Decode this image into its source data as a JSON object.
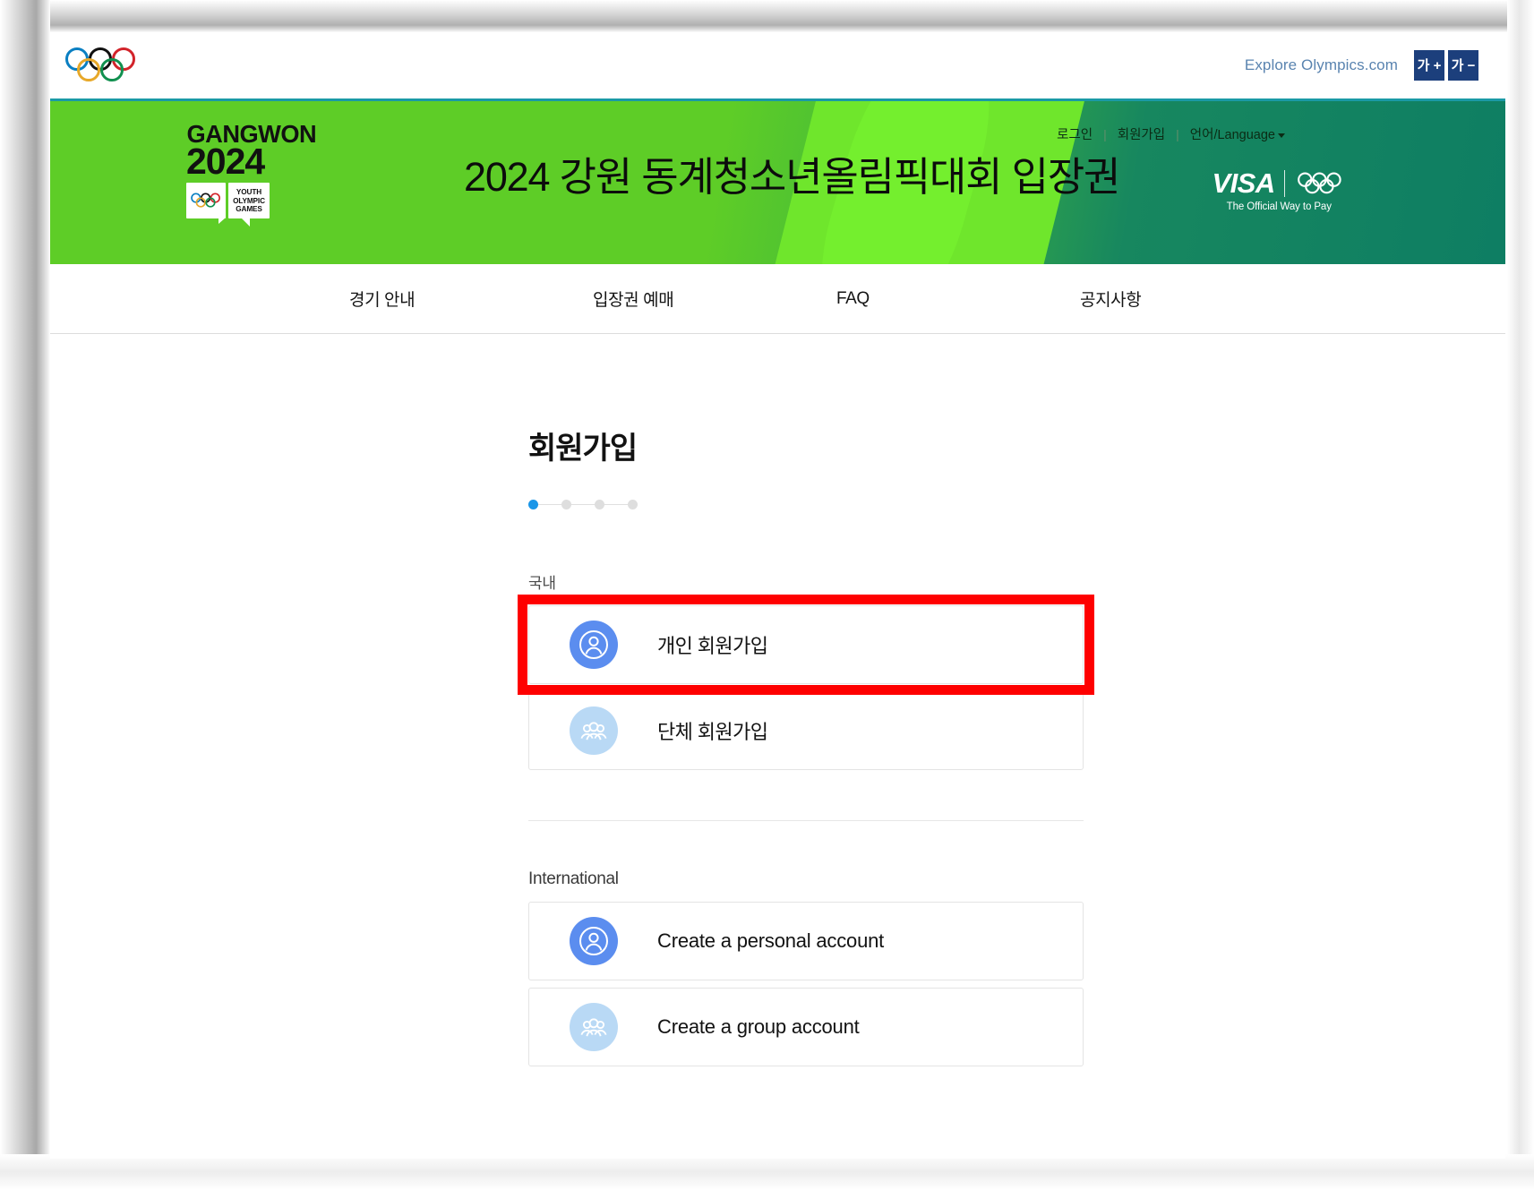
{
  "utility_bar": {
    "logo": "olympic-rings-logo",
    "explore_link": "Explore Olympics.com",
    "font_increase": "가 +",
    "font_decrease": "가 −"
  },
  "hero": {
    "logo": {
      "line1": "GANGWON",
      "line2": "2024",
      "emblem_line1": "YOUTH",
      "emblem_line2": "OLYMPIC",
      "emblem_line3": "GAMES"
    },
    "title": "2024 강원 동계청소년올림픽대회 입장권",
    "links": {
      "login": "로그인",
      "separator": "|",
      "signup": "회원가입",
      "language": "언어/Language"
    },
    "sponsor": {
      "brand": "VISA",
      "tagline": "The Official Way to Pay"
    },
    "colors": {
      "green_light": "#6fe62c",
      "green": "#5ecd27",
      "green_dark": "#0e7e63",
      "accent_rule": "#1b9aa6"
    }
  },
  "nav": {
    "items": [
      {
        "label": "경기 안내"
      },
      {
        "label": "입장권 예매"
      },
      {
        "label": "FAQ"
      },
      {
        "label": "공지사항"
      }
    ]
  },
  "main": {
    "page_title": "회원가입",
    "steps": {
      "total": 4,
      "current": 1,
      "active_color": "#1a96e8",
      "inactive_color": "#dedede"
    },
    "domestic": {
      "label": "국내",
      "options": [
        {
          "label": "개인 회원가입",
          "icon": "person-icon",
          "icon_style": "solid",
          "highlighted": true
        },
        {
          "label": "단체 회원가입",
          "icon": "group-icon",
          "icon_style": "pale",
          "highlighted": false
        }
      ]
    },
    "international": {
      "label": "International",
      "options": [
        {
          "label": "Create a personal account",
          "icon": "person-icon",
          "icon_style": "solid",
          "highlighted": false
        },
        {
          "label": "Create a group account",
          "icon": "group-icon",
          "icon_style": "pale",
          "highlighted": false
        }
      ]
    },
    "highlight_color": "#fe0000"
  }
}
